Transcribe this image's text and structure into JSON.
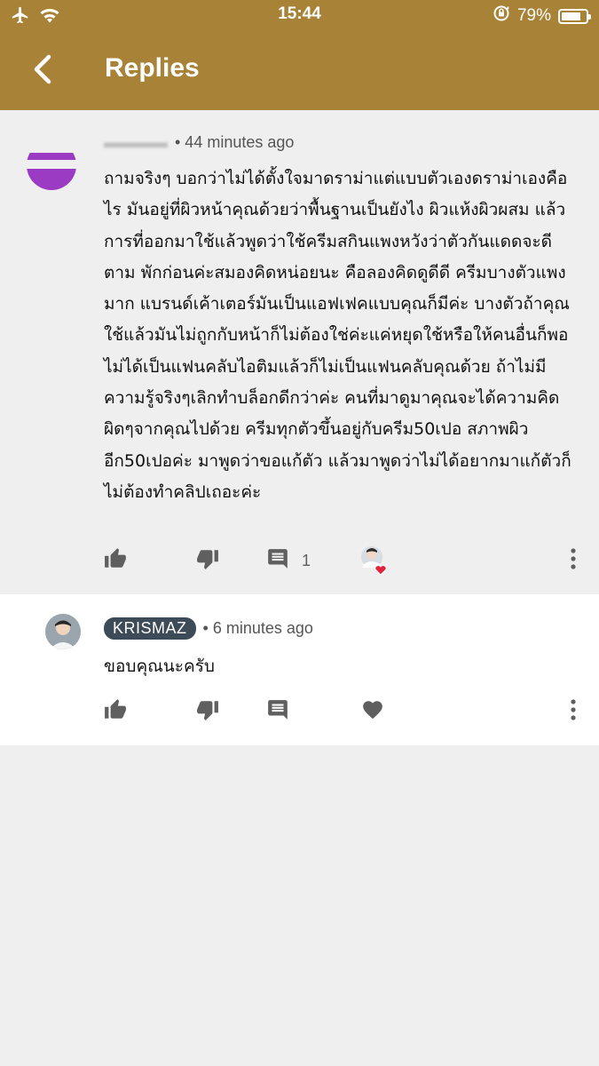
{
  "status_bar": {
    "time": "15:44",
    "battery_percent": "79%",
    "battery_level": 0.79,
    "icons": [
      "airplane-icon",
      "wifi-icon",
      "orientation-lock-icon",
      "battery-icon"
    ]
  },
  "header": {
    "title": "Replies",
    "back_icon": "back-arrow-icon",
    "background_color": "#a88236"
  },
  "parent_comment": {
    "time_ago": "• 44 minutes ago",
    "text": "ถามจริงๆ บอกว่าไม่ได้ตั้งใจมาดราม่าแต่แบบตัวเองดราม่าเองคือไร มันอยู่ที่ผิวหน้าคุณด้วยว่าพื้นฐานเป็นยังไง ผิวแห้งผิวผสม  แล้วการที่ออกมาใช้แล้วพูดว่าใช้ครีมสกินแพงหวังว่าตัวกันแดดจะดีตาม พักก่อนค่ะสมองคิดหน่อยนะ คือลองคิดดูดีดี ครีมบางตัวแพงมาก แบรนด์เค้าเตอร์มันเป็นแอฟเฟคแบบคุณก็มีค่ะ บางตัวถ้าคุณใช้แล้วมันไม่ถูกกับหน้าก็ไม่ต้องใช่ค่ะแค่หยุดใช้หรือให้คนอื่นก็พอ  ไม่ได้เป็นแฟนคลับไอติมแล้วก็ไม่เป็นแฟนคลับคุณด้วย ถ้าไม่มีความรู้จริงๆเลิกทำบล็อกดีกว่าค่ะ คนที่มาดูมาคุณจะได้ความคิดผิดๆจากคุณไปด้วย ครีมทุกตัวขึ้นอยู่กับครีม50เปอ สภาพผิว อีก50เปอค่ะ  มาพูดว่าขอแก้ตัว แล้วมาพูดว่าไม่ได้อยากมาแก้ตัวก็ไม่ต้องทำคลิปเถอะค่ะ",
    "reply_count": "1",
    "avatar_color": "#9b3bc4"
  },
  "reply_comment": {
    "username": "KRISMAZ",
    "time_ago": "• 6 minutes ago",
    "text": "ขอบคุณนะครับ"
  },
  "colors": {
    "accent": "#a88236",
    "heart": "#e0243a",
    "icon_gray": "#5f5f5f",
    "chip": "#3d4a57"
  }
}
